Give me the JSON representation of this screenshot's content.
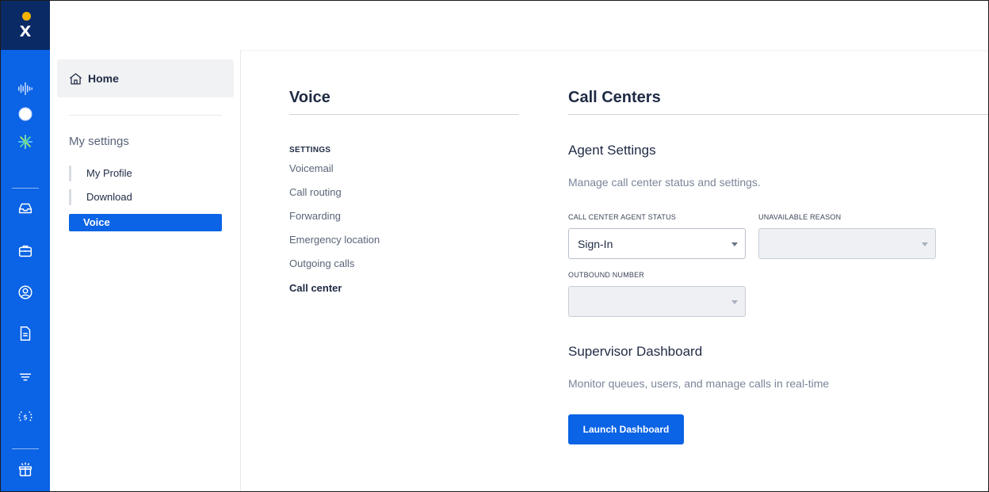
{
  "rail": {
    "logo_letter": "x",
    "colors": {
      "rail": "#0b63e5",
      "logo_bg": "#0a2a66",
      "logo_dot": "#f6b400",
      "accent": "#0b63e5"
    },
    "icons": [
      "voice-wave-icon",
      "circle-icon",
      "sparkle-icon",
      "inbox-icon",
      "briefcase-icon",
      "user-circle-icon",
      "document-icon",
      "filter-icon",
      "billing-icon",
      "gift-icon"
    ]
  },
  "sidebar": {
    "home_label": "Home",
    "heading": "My settings",
    "items": [
      {
        "label": "My Profile",
        "active": false
      },
      {
        "label": "Download",
        "active": false
      },
      {
        "label": "Voice",
        "active": true
      }
    ]
  },
  "voice": {
    "title": "Voice",
    "settings_label": "SETTINGS",
    "links": [
      "Voicemail",
      "Call routing",
      "Forwarding",
      "Emergency location",
      "Outgoing calls",
      "Call center"
    ],
    "current": "Call center"
  },
  "call_centers": {
    "title": "Call Centers",
    "agent": {
      "title": "Agent Settings",
      "description": "Manage call center status and settings.",
      "status_label": "CALL CENTER AGENT STATUS",
      "status_value": "Sign-In",
      "reason_label": "UNAVAILABLE REASON",
      "reason_value": "",
      "outbound_label": "OUTBOUND NUMBER",
      "outbound_value": ""
    },
    "supervisor": {
      "title": "Supervisor Dashboard",
      "description": "Monitor queues, users, and manage calls in real-time",
      "button_label": "Launch Dashboard"
    }
  }
}
